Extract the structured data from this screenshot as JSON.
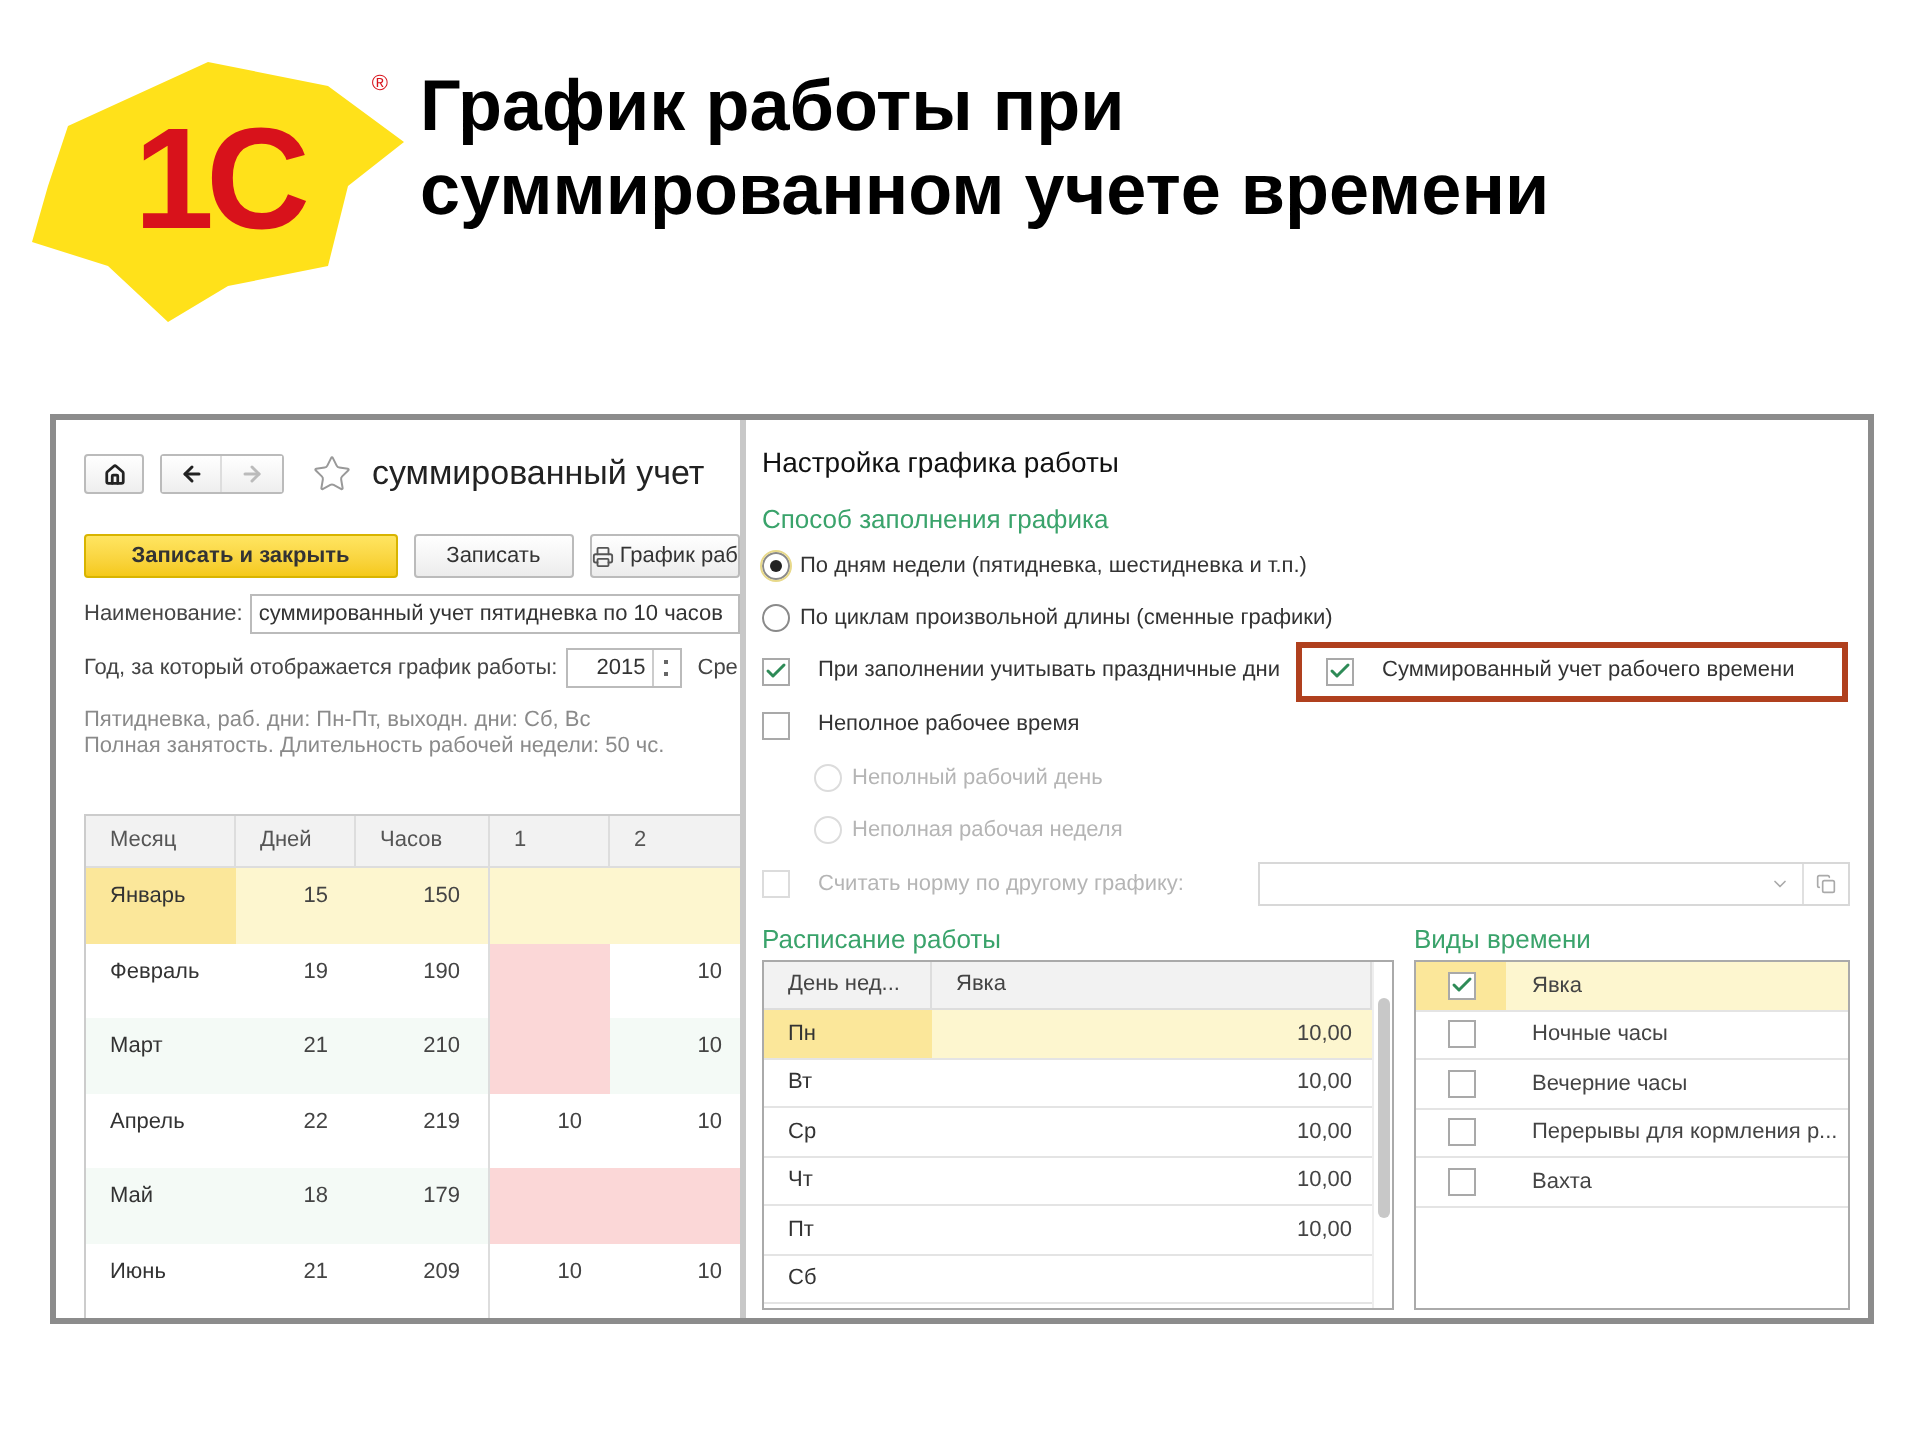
{
  "logo": {
    "text": "1С",
    "mark": "®"
  },
  "title": [
    "График работы при",
    "суммированном учете времени"
  ],
  "form": {
    "title": "суммированный учет",
    "buttons": [
      {
        "label": "Записать и закрыть",
        "kind": "primary"
      },
      {
        "label": "Записать",
        "kind": "plain"
      },
      {
        "label": "График раб",
        "kind": "print"
      }
    ],
    "name_label": "Наименование:",
    "name_value": "суммированный учет пятидневка по 10 часов",
    "year_label": "Год, за который отображается график работы:",
    "year_value": "2015",
    "cut_label": "Сре",
    "info": [
      "Пятидневка, раб. дни: Пн-Пт, выходн. дни: Сб, Вс",
      "Полная занятость. Длительность рабочей недели: 50 чс."
    ],
    "table": {
      "columns": [
        "Месяц",
        "Дней",
        "Часов",
        "1",
        "2"
      ],
      "rows": [
        {
          "month": "Январь",
          "days": "15",
          "hours": "150",
          "selected": true,
          "cells": [
            {
              "holiday": false
            },
            {
              "holiday": false
            }
          ]
        },
        {
          "month": "Февраль",
          "days": "19",
          "hours": "190",
          "selected": false,
          "cells": [
            {
              "holiday": true
            },
            {
              "value": "10",
              "holiday": false
            }
          ]
        },
        {
          "month": "Март",
          "days": "21",
          "hours": "210",
          "selected": false,
          "cells": [
            {
              "holiday": true
            },
            {
              "value": "10",
              "holiday": false
            }
          ]
        },
        {
          "month": "Апрель",
          "days": "22",
          "hours": "219",
          "selected": false,
          "cells": [
            {
              "value": "10",
              "holiday": false
            },
            {
              "value": "10",
              "holiday": false
            }
          ]
        },
        {
          "month": "Май",
          "days": "18",
          "hours": "179",
          "selected": false,
          "cells": [
            {
              "holiday": true
            },
            {
              "holiday": true
            }
          ]
        },
        {
          "month": "Июнь",
          "days": "21",
          "hours": "209",
          "selected": false,
          "cells": [
            {
              "value": "10",
              "holiday": false
            },
            {
              "value": "10",
              "holiday": false
            }
          ]
        }
      ]
    }
  },
  "dialog": {
    "title": "Настройка графика работы",
    "fill_section": "Способ заполнения графика",
    "options": [
      {
        "kind": "radio",
        "label": "По дням недели (пятидневка, шестидневка и т.п.)",
        "selected": true,
        "disabled": false,
        "indent": false
      },
      {
        "kind": "radio",
        "label": "По циклам произвольной длины (сменные графики)",
        "selected": false,
        "disabled": false,
        "indent": false
      },
      {
        "kind": "checkbox-pair",
        "label": "При заполнении учитывать праздничные дни",
        "checked": true,
        "extra": {
          "label": "Суммированный учет рабочего времени",
          "checked": true,
          "highlighted": true
        }
      },
      {
        "kind": "checkbox",
        "label": "Неполное рабочее время",
        "checked": false,
        "disabled": false
      },
      {
        "kind": "radio",
        "label": "Неполный рабочий день",
        "selected": false,
        "disabled": true,
        "indent": true
      },
      {
        "kind": "radio",
        "label": "Неполная рабочая неделя",
        "selected": false,
        "disabled": true,
        "indent": true
      },
      {
        "kind": "checkbox-field",
        "label": "Считать норму по другому графику:",
        "checked": false,
        "disabled": true
      }
    ],
    "schedule": {
      "title": "Расписание работы",
      "columns": [
        "День нед...",
        "Явка"
      ],
      "rows": [
        {
          "day": "Пн",
          "value": "10,00",
          "selected": true
        },
        {
          "day": "Вт",
          "value": "10,00",
          "selected": false
        },
        {
          "day": "Ср",
          "value": "10,00",
          "selected": false
        },
        {
          "day": "Чт",
          "value": "10,00",
          "selected": false
        },
        {
          "day": "Пт",
          "value": "10,00",
          "selected": false
        },
        {
          "day": "Сб",
          "selected": false
        }
      ]
    },
    "time_types": {
      "title": "Виды времени",
      "items": [
        {
          "label": "Явка",
          "checked": true,
          "selected": true
        },
        {
          "label": "Ночные часы",
          "checked": false,
          "selected": false
        },
        {
          "label": "Вечерние часы",
          "checked": false,
          "selected": false
        },
        {
          "label": "Перерывы для кормления р...",
          "checked": false,
          "selected": false
        },
        {
          "label": "Вахта",
          "checked": false,
          "selected": false
        }
      ]
    }
  }
}
